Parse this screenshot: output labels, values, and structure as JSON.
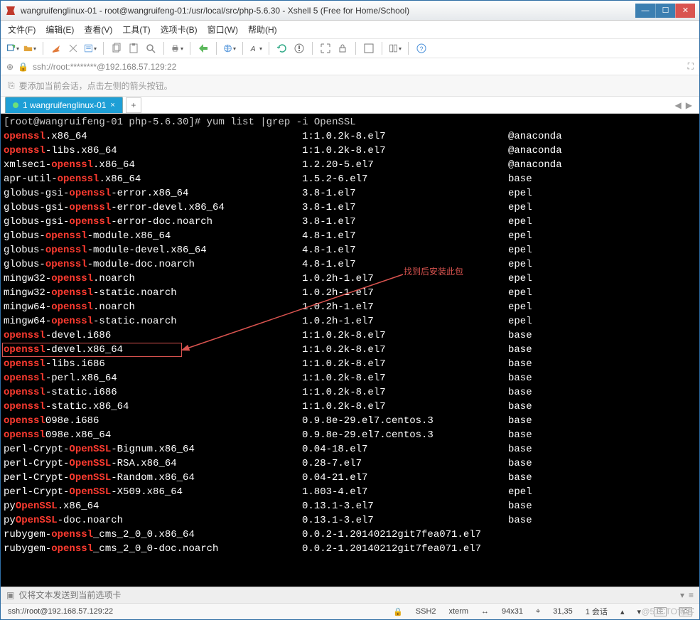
{
  "window": {
    "title": "wangruifenglinux-01 - root@wangruifeng-01:/usr/local/src/php-5.6.30 - Xshell 5 (Free for Home/School)"
  },
  "menu": {
    "items": [
      "文件(F)",
      "编辑(E)",
      "查看(V)",
      "工具(T)",
      "选项卡(B)",
      "窗口(W)",
      "帮助(H)"
    ]
  },
  "addressbar": {
    "text": "ssh://root:********@192.168.57.129:22"
  },
  "hint": {
    "text": "要添加当前会话，点击左侧的箭头按钮。"
  },
  "tab": {
    "label": "1 wangruifenglinux-01"
  },
  "prompt": "[root@wangruifeng-01 php-5.6.30]# yum list |grep -i OpenSSL",
  "rows": [
    {
      "name": [
        "openssl",
        ".x86_64"
      ],
      "ver": "1:1.0.2k-8.el7",
      "repo": "@anaconda"
    },
    {
      "name": [
        "openssl",
        "-libs.x86_64"
      ],
      "ver": "1:1.0.2k-8.el7",
      "repo": "@anaconda"
    },
    {
      "name": [
        "xmlsec1-",
        "openssl",
        ".x86_64"
      ],
      "ver": "1.2.20-5.el7",
      "repo": "@anaconda"
    },
    {
      "name": [
        "apr-util-",
        "openssl",
        ".x86_64"
      ],
      "ver": "1.5.2-6.el7",
      "repo": "base"
    },
    {
      "name": [
        "globus-gsi-",
        "openssl",
        "-error.x86_64"
      ],
      "ver": "3.8-1.el7",
      "repo": "epel"
    },
    {
      "name": [
        "globus-gsi-",
        "openssl",
        "-error-devel.x86_64"
      ],
      "ver": "3.8-1.el7",
      "repo": "epel"
    },
    {
      "name": [
        "globus-gsi-",
        "openssl",
        "-error-doc.noarch"
      ],
      "ver": "3.8-1.el7",
      "repo": "epel"
    },
    {
      "name": [
        "globus-",
        "openssl",
        "-module.x86_64"
      ],
      "ver": "4.8-1.el7",
      "repo": "epel"
    },
    {
      "name": [
        "globus-",
        "openssl",
        "-module-devel.x86_64"
      ],
      "ver": "4.8-1.el7",
      "repo": "epel"
    },
    {
      "name": [
        "globus-",
        "openssl",
        "-module-doc.noarch"
      ],
      "ver": "4.8-1.el7",
      "repo": "epel"
    },
    {
      "name": [
        "mingw32-",
        "openssl",
        ".noarch"
      ],
      "ver": "1.0.2h-1.el7",
      "repo": "epel"
    },
    {
      "name": [
        "mingw32-",
        "openssl",
        "-static.noarch"
      ],
      "ver": "1.0.2h-1.el7",
      "repo": "epel"
    },
    {
      "name": [
        "mingw64-",
        "openssl",
        ".noarch"
      ],
      "ver": "1.0.2h-1.el7",
      "repo": "epel"
    },
    {
      "name": [
        "mingw64-",
        "openssl",
        "-static.noarch"
      ],
      "ver": "1.0.2h-1.el7",
      "repo": "epel"
    },
    {
      "name": [
        "openssl",
        "-devel.i686"
      ],
      "ver": "1:1.0.2k-8.el7",
      "repo": "base"
    },
    {
      "name": [
        "openssl",
        "-devel.x86_64"
      ],
      "ver": "1:1.0.2k-8.el7",
      "repo": "base"
    },
    {
      "name": [
        "openssl",
        "-libs.i686"
      ],
      "ver": "1:1.0.2k-8.el7",
      "repo": "base"
    },
    {
      "name": [
        "openssl",
        "-perl.x86_64"
      ],
      "ver": "1:1.0.2k-8.el7",
      "repo": "base"
    },
    {
      "name": [
        "openssl",
        "-static.i686"
      ],
      "ver": "1:1.0.2k-8.el7",
      "repo": "base"
    },
    {
      "name": [
        "openssl",
        "-static.x86_64"
      ],
      "ver": "1:1.0.2k-8.el7",
      "repo": "base"
    },
    {
      "name": [
        "openssl",
        "098e.i686"
      ],
      "ver": "0.9.8e-29.el7.centos.3",
      "repo": "base"
    },
    {
      "name": [
        "openssl",
        "098e.x86_64"
      ],
      "ver": "0.9.8e-29.el7.centos.3",
      "repo": "base"
    },
    {
      "name": [
        "perl-Crypt-",
        "OpenSSL",
        "-Bignum.x86_64"
      ],
      "ver": "0.04-18.el7",
      "repo": "base"
    },
    {
      "name": [
        "perl-Crypt-",
        "OpenSSL",
        "-RSA.x86_64"
      ],
      "ver": "0.28-7.el7",
      "repo": "base"
    },
    {
      "name": [
        "perl-Crypt-",
        "OpenSSL",
        "-Random.x86_64"
      ],
      "ver": "0.04-21.el7",
      "repo": "base"
    },
    {
      "name": [
        "perl-Crypt-",
        "OpenSSL",
        "-X509.x86_64"
      ],
      "ver": "1.803-4.el7",
      "repo": "epel"
    },
    {
      "name": [
        "py",
        "OpenSSL",
        ".x86_64"
      ],
      "ver": "0.13.1-3.el7",
      "repo": "base"
    },
    {
      "name": [
        "py",
        "OpenSSL",
        "-doc.noarch"
      ],
      "ver": "0.13.1-3.el7",
      "repo": "base"
    },
    {
      "name": [
        "rubygem-",
        "openssl",
        "_cms_2_0_0.x86_64"
      ],
      "ver": "0.0.2-1.20140212git7fea071.el7",
      "repo": ""
    },
    {
      "name": [
        "rubygem-",
        "openssl",
        "_cms_2_0_0-doc.noarch"
      ],
      "ver": "0.0.2-1.20140212git7fea071.el7",
      "repo": ""
    }
  ],
  "annotation": {
    "text": "找到后安装此包"
  },
  "sendbar": {
    "placeholder": "仅将文本发送到当前选项卡"
  },
  "status": {
    "conn": "ssh://root@192.168.57.129:22",
    "proto": "SSH2",
    "term": "xterm",
    "size": "94x31",
    "pos": "31,35",
    "sessions": "1 会话"
  },
  "watermark": "@51CTO博客"
}
